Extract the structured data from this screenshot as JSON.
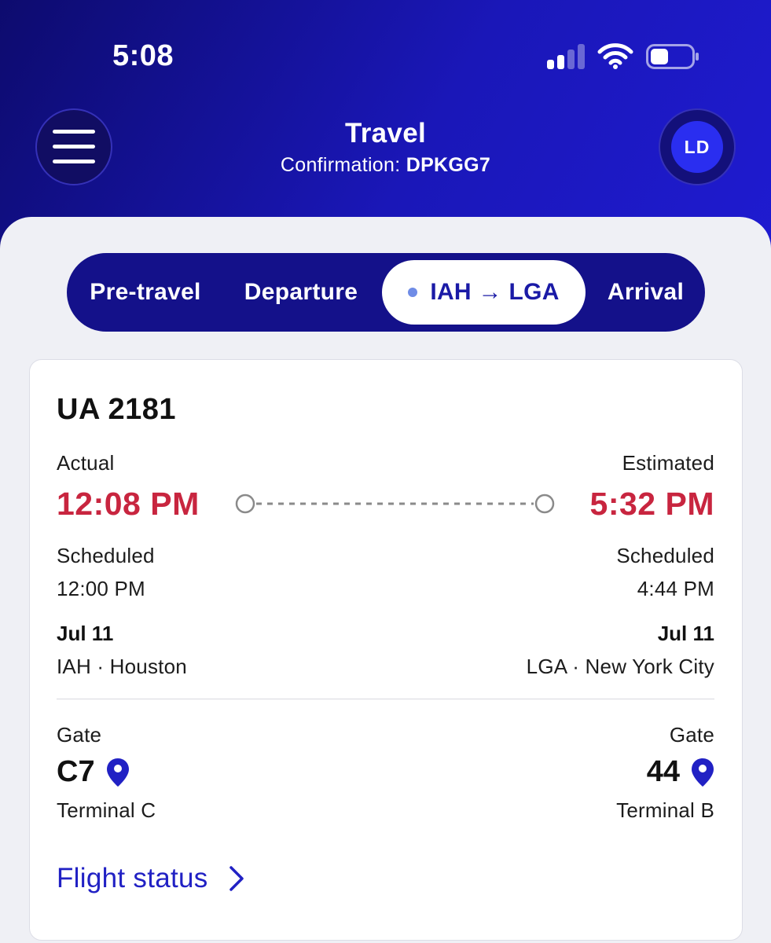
{
  "status_bar": {
    "time": "5:08"
  },
  "header": {
    "title": "Travel",
    "confirmation_label": "Confirmation:",
    "confirmation_code": "DPKGG7",
    "avatar_initials": "LD",
    "menu_icon": "hamburger-icon"
  },
  "tabs": {
    "items": [
      {
        "label": "Pre-travel"
      },
      {
        "label": "Departure"
      },
      {
        "label": "IAH → LGA",
        "active": true
      },
      {
        "label": "Arrival"
      }
    ]
  },
  "flight": {
    "number": "UA 2181",
    "departure": {
      "status_label": "Actual",
      "time": "12:08 PM",
      "scheduled_label": "Scheduled",
      "scheduled_time": "12:00 PM",
      "date": "Jul 11",
      "airport": "IAH · Houston",
      "gate_label": "Gate",
      "gate": "C7",
      "terminal": "Terminal C"
    },
    "arrival": {
      "status_label": "Estimated",
      "time": "5:32 PM",
      "scheduled_label": "Scheduled",
      "scheduled_time": "4:44 PM",
      "date": "Jul 11",
      "airport": "LGA · New York City",
      "gate_label": "Gate",
      "gate": "44",
      "terminal": "Terminal B"
    },
    "flight_status_link": "Flight status"
  },
  "colors": {
    "header_blue": "#1a17b8",
    "tab_bar": "#14118a",
    "delay_red": "#c8253f",
    "link_blue": "#2121c4",
    "pin_blue": "#2121c4",
    "avatar": "#2a2ef0"
  }
}
